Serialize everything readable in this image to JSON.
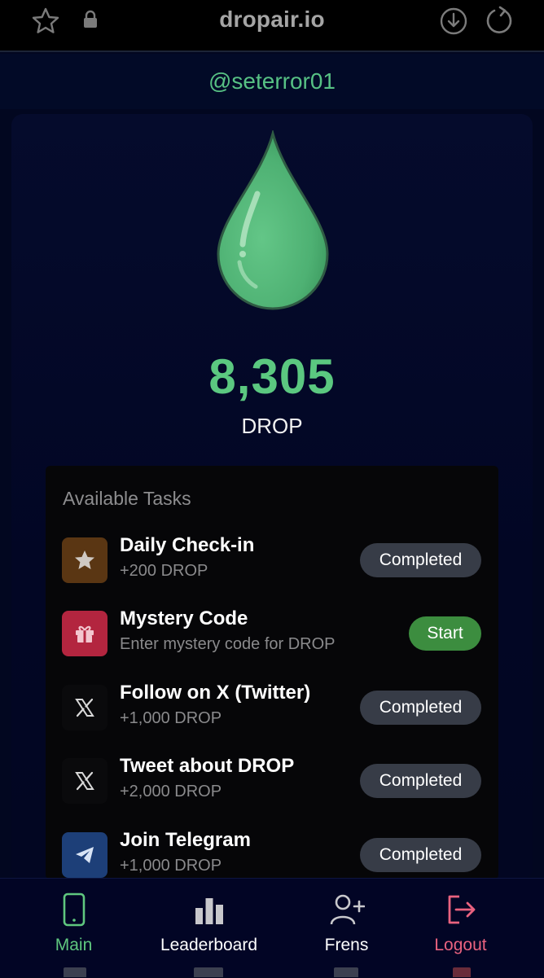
{
  "browser": {
    "url": "dropair.io",
    "icons": [
      "star-icon",
      "lock-icon",
      "download-icon",
      "reload-icon"
    ]
  },
  "profile": {
    "username": "@seterror01"
  },
  "balance": {
    "amount": "8,305",
    "currency": "DROP"
  },
  "tasks": {
    "title": "Available Tasks",
    "items": [
      {
        "name": "Daily Check-in",
        "reward": "+200 DROP",
        "action": "Completed",
        "icon": "star-icon",
        "icon_bg": "#5a3613"
      },
      {
        "name": "Mystery Code",
        "reward": "Enter mystery code for DROP",
        "action": "Start",
        "icon": "gift-icon",
        "icon_bg": "#b3253f"
      },
      {
        "name": "Follow on X (Twitter)",
        "reward": "+1,000 DROP",
        "action": "Completed",
        "icon": "x-logo-icon",
        "icon_bg": "#0a0a0c"
      },
      {
        "name": "Tweet about DROP",
        "reward": "+2,000 DROP",
        "action": "Completed",
        "icon": "x-logo-icon",
        "icon_bg": "#0a0a0c"
      },
      {
        "name": "Join Telegram",
        "reward": "+1,000 DROP",
        "action": "Completed",
        "icon": "telegram-icon",
        "icon_bg": "#1d3f78"
      }
    ]
  },
  "nav": {
    "items": [
      {
        "label": "Main",
        "icon": "phone-icon",
        "color": "#5fc77f"
      },
      {
        "label": "Leaderboard",
        "icon": "bar-chart-icon",
        "color": "#ffffff"
      },
      {
        "label": "Frens",
        "icon": "user-plus-icon",
        "color": "#ffffff"
      },
      {
        "label": "Logout",
        "icon": "logout-icon",
        "color": "#e9627f"
      }
    ]
  },
  "colors": {
    "accent_green": "#5bc880",
    "completed_btn": "#373c47",
    "start_btn": "#3c8d3f",
    "logout": "#e9627f"
  }
}
